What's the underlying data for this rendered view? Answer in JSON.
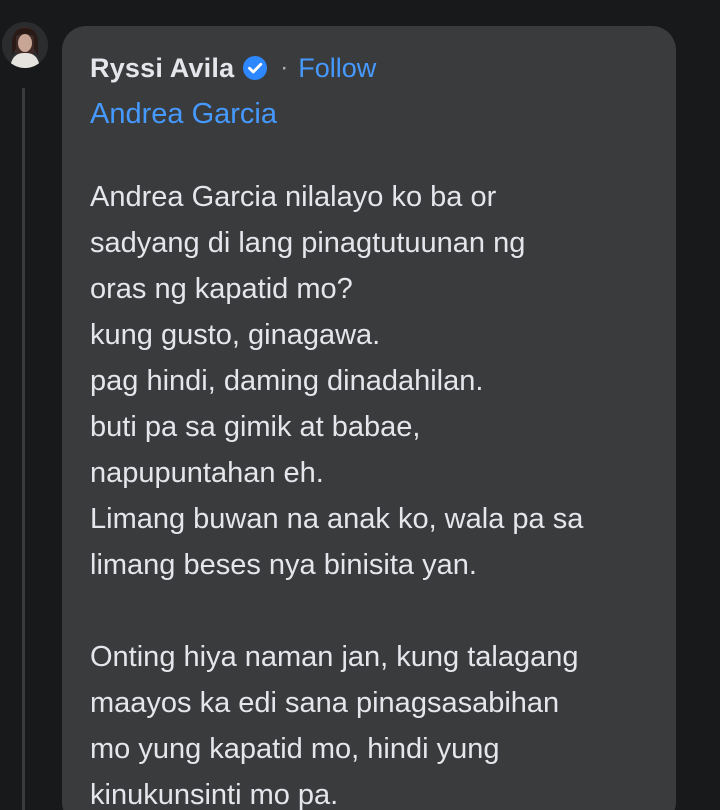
{
  "comment": {
    "author": "Ryssi Avila",
    "separator": "·",
    "follow_label": "Follow",
    "mention": "Andrea Garcia",
    "paragraphs": [
      [
        "Andrea Garcia nilalayo ko ba or",
        "sadyang di lang pinagtutuunan ng",
        "oras ng kapatid mo?",
        "kung gusto, ginagawa.",
        "pag hindi, daming dinadahilan.",
        "buti pa sa gimik at babae,",
        "napupuntahan eh.",
        "Limang buwan na anak ko, wala pa sa",
        "limang beses nya binisita yan."
      ],
      [
        "Onting hiya naman jan, kung talagang",
        "maayos ka edi sana pinagsasabihan",
        "mo yung kapatid mo, hindi yung",
        "kinukunsinti mo pa."
      ]
    ]
  },
  "colors": {
    "background": "#18191a",
    "bubble": "#3a3b3c",
    "text": "#e4e6eb",
    "link": "#4599ff",
    "verified": "#2d88ff"
  },
  "icons": {
    "avatar": "profile-photo",
    "badge": "verified-badge-icon"
  }
}
